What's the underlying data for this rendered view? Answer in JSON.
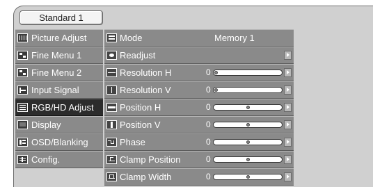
{
  "tab": {
    "label": "Standard 1"
  },
  "menu": {
    "items": [
      {
        "label": "Picture Adjust",
        "icon": "picture-adjust-icon"
      },
      {
        "label": "Fine Menu 1",
        "icon": "fine-menu-icon"
      },
      {
        "label": "Fine Menu 2",
        "icon": "fine-menu-icon"
      },
      {
        "label": "Input Signal",
        "icon": "input-signal-icon"
      },
      {
        "label": "RGB/HD Adjust",
        "icon": "rgb-hd-icon",
        "active": true
      },
      {
        "label": "Display",
        "icon": "display-icon"
      },
      {
        "label": "OSD/Blanking",
        "icon": "osd-blanking-icon"
      },
      {
        "label": "Config.",
        "icon": "config-icon"
      }
    ]
  },
  "settings": {
    "rows": [
      {
        "label": "Mode",
        "icon": "mode-icon",
        "value": "Memory 1"
      },
      {
        "label": "Readjust",
        "icon": "readjust-icon"
      },
      {
        "label": "Resolution H",
        "icon": "resolution-h-icon",
        "number": "0",
        "level": 0.0
      },
      {
        "label": "Resolution V",
        "icon": "resolution-v-icon",
        "number": "0",
        "level": 0.0
      },
      {
        "label": "Position H",
        "icon": "position-h-icon",
        "number": "0",
        "level": 0.5
      },
      {
        "label": "Position V",
        "icon": "position-v-icon",
        "number": "0",
        "level": 0.5
      },
      {
        "label": "Phase",
        "icon": "phase-icon",
        "number": "0",
        "level": 0.5
      },
      {
        "label": "Clamp Position",
        "icon": "clamp-position-icon",
        "number": "0",
        "level": 0.5
      },
      {
        "label": "Clamp Width",
        "icon": "clamp-width-icon",
        "number": "0",
        "level": 0.5
      }
    ]
  },
  "colors": {
    "item_bg": "#8a8a8a",
    "active_bg": "#2c2c2c",
    "osd_bg": "#d0d0d0"
  }
}
